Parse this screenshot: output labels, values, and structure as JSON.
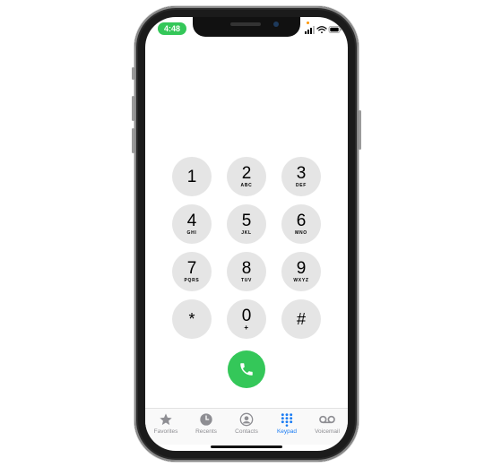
{
  "status_bar": {
    "time": "4:48"
  },
  "keypad": {
    "keys": [
      {
        "number": "1",
        "letters": ""
      },
      {
        "number": "2",
        "letters": "ABC"
      },
      {
        "number": "3",
        "letters": "DEF"
      },
      {
        "number": "4",
        "letters": "GHI"
      },
      {
        "number": "5",
        "letters": "JKL"
      },
      {
        "number": "6",
        "letters": "MNO"
      },
      {
        "number": "7",
        "letters": "PQRS"
      },
      {
        "number": "8",
        "letters": "TUV"
      },
      {
        "number": "9",
        "letters": "WXYZ"
      },
      {
        "number": "*",
        "letters": ""
      },
      {
        "number": "0",
        "letters": "+"
      },
      {
        "number": "#",
        "letters": ""
      }
    ]
  },
  "call_button": {
    "icon": "phone-icon",
    "color": "#34c759"
  },
  "tabs": [
    {
      "label": "Favorites",
      "icon": "star-icon",
      "active": false
    },
    {
      "label": "Recents",
      "icon": "clock-icon",
      "active": false
    },
    {
      "label": "Contacts",
      "icon": "person-circle-icon",
      "active": false
    },
    {
      "label": "Keypad",
      "icon": "keypad-grid-icon",
      "active": true
    },
    {
      "label": "Voicemail",
      "icon": "voicemail-icon",
      "active": false
    }
  ],
  "colors": {
    "accent": "#1a7cf3",
    "call_green": "#34c759",
    "key_gray": "#e5e5e5",
    "inactive": "#8e8e93"
  }
}
